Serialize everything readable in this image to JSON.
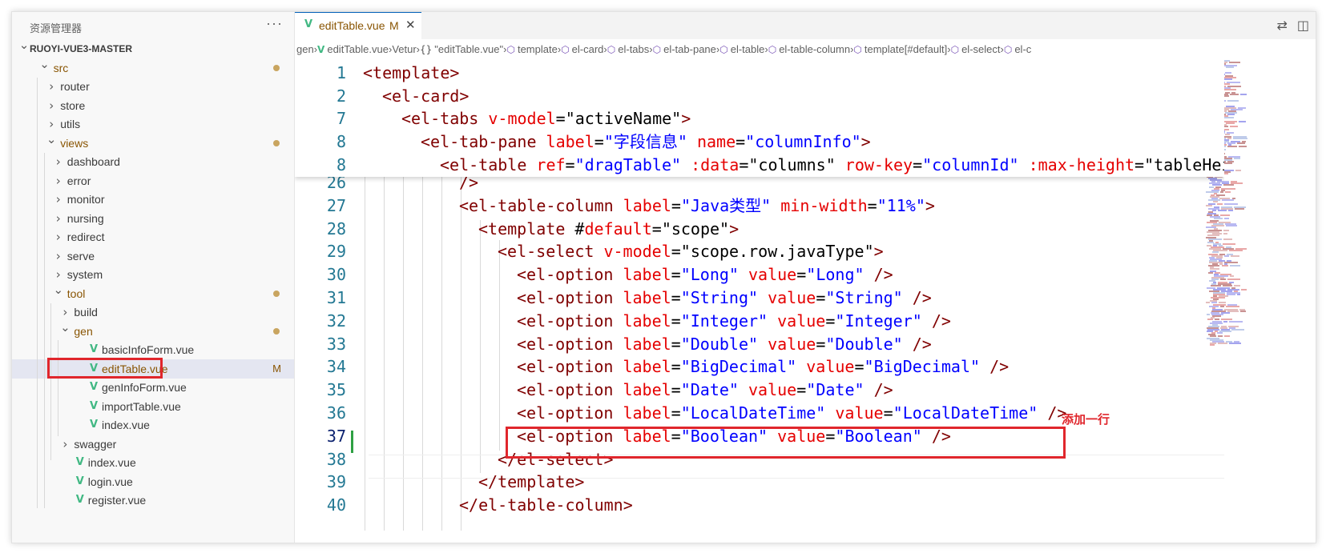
{
  "explorer": {
    "title": "资源管理器",
    "more_label": "···",
    "tree": [
      {
        "label": "RUOYI-VUE3-MASTER",
        "kind": "root",
        "expanded": true,
        "depth": 0,
        "modified_dot": false
      },
      {
        "label": "src",
        "kind": "folder",
        "expanded": true,
        "depth": 1,
        "modified_dot": true,
        "modified": true
      },
      {
        "label": "router",
        "kind": "folder",
        "expanded": false,
        "depth": 2,
        "modified_dot": false
      },
      {
        "label": "store",
        "kind": "folder",
        "expanded": false,
        "depth": 2,
        "modified_dot": false
      },
      {
        "label": "utils",
        "kind": "folder",
        "expanded": false,
        "depth": 2,
        "modified_dot": false
      },
      {
        "label": "views",
        "kind": "folder",
        "expanded": true,
        "depth": 2,
        "modified_dot": true,
        "modified": true
      },
      {
        "label": "dashboard",
        "kind": "folder",
        "expanded": false,
        "depth": 3,
        "modified_dot": false
      },
      {
        "label": "error",
        "kind": "folder",
        "expanded": false,
        "depth": 3,
        "modified_dot": false
      },
      {
        "label": "monitor",
        "kind": "folder",
        "expanded": false,
        "depth": 3,
        "modified_dot": false
      },
      {
        "label": "nursing",
        "kind": "folder",
        "expanded": false,
        "depth": 3,
        "modified_dot": false
      },
      {
        "label": "redirect",
        "kind": "folder",
        "expanded": false,
        "depth": 3,
        "modified_dot": false
      },
      {
        "label": "serve",
        "kind": "folder",
        "expanded": false,
        "depth": 3,
        "modified_dot": false
      },
      {
        "label": "system",
        "kind": "folder",
        "expanded": false,
        "depth": 3,
        "modified_dot": false
      },
      {
        "label": "tool",
        "kind": "folder",
        "expanded": true,
        "depth": 3,
        "modified_dot": true,
        "modified": true
      },
      {
        "label": "build",
        "kind": "folder",
        "expanded": false,
        "depth": 4,
        "modified_dot": false
      },
      {
        "label": "gen",
        "kind": "folder",
        "expanded": true,
        "depth": 4,
        "modified_dot": true,
        "modified": true
      },
      {
        "label": "basicInfoForm.vue",
        "kind": "vue",
        "depth": 5,
        "modified_dot": false
      },
      {
        "label": "editTable.vue",
        "kind": "vue",
        "depth": 5,
        "selected": true,
        "modified": true,
        "flag": "M"
      },
      {
        "label": "genInfoForm.vue",
        "kind": "vue",
        "depth": 5,
        "modified_dot": false
      },
      {
        "label": "importTable.vue",
        "kind": "vue",
        "depth": 5,
        "modified_dot": false
      },
      {
        "label": "index.vue",
        "kind": "vue",
        "depth": 5,
        "modified_dot": false
      },
      {
        "label": "swagger",
        "kind": "folder",
        "expanded": false,
        "depth": 4,
        "modified_dot": false
      },
      {
        "label": "index.vue",
        "kind": "vue",
        "depth": 3,
        "modified_dot": false
      },
      {
        "label": "login.vue",
        "kind": "vue",
        "depth": 3,
        "modified_dot": false
      },
      {
        "label": "register.vue",
        "kind": "vue",
        "depth": 3,
        "modified_dot": false
      }
    ]
  },
  "tab": {
    "label": "editTable.vue",
    "flag": "M",
    "close": "✕",
    "icon": "vue-icon"
  },
  "tab_actions": {
    "compare": "⇄",
    "split": "◫"
  },
  "breadcrumb": [
    {
      "label": "gen",
      "icon": ""
    },
    {
      "label": "editTable.vue",
      "icon": "vue"
    },
    {
      "label": "Vetur",
      "icon": ""
    },
    {
      "label": "\"editTable.vue\"",
      "icon": "braces"
    },
    {
      "label": "template",
      "icon": "cube"
    },
    {
      "label": "el-card",
      "icon": "cube"
    },
    {
      "label": "el-tabs",
      "icon": "cube"
    },
    {
      "label": "el-tab-pane",
      "icon": "cube"
    },
    {
      "label": "el-table",
      "icon": "cube"
    },
    {
      "label": "el-table-column",
      "icon": "cube"
    },
    {
      "label": "template[#default]",
      "icon": "cube"
    },
    {
      "label": "el-select",
      "icon": "cube"
    },
    {
      "label": "el-c",
      "icon": "cube"
    }
  ],
  "sticky_lines": [
    {
      "num": "1",
      "indent": 0,
      "tokens": [
        [
          "tag",
          "<template>"
        ]
      ]
    },
    {
      "num": "2",
      "indent": 1,
      "tokens": [
        [
          "tag",
          "<el-card>"
        ]
      ]
    },
    {
      "num": "7",
      "indent": 2,
      "tokens": [
        [
          "tag",
          "<el-tabs "
        ],
        [
          "attr",
          "v-model"
        ],
        [
          "eq",
          "="
        ],
        [
          "str2",
          "\"activeName\""
        ],
        [
          "tag",
          ">"
        ]
      ]
    },
    {
      "num": "8",
      "indent": 3,
      "tokens": [
        [
          "tag",
          "<el-tab-pane "
        ],
        [
          "attr",
          "label"
        ],
        [
          "eq",
          "="
        ],
        [
          "str",
          "\"字段信息\""
        ],
        [
          "plain",
          " "
        ],
        [
          "attr",
          "name"
        ],
        [
          "eq",
          "="
        ],
        [
          "str",
          "\"columnInfo\""
        ],
        [
          "tag",
          ">"
        ]
      ]
    },
    {
      "num": "8",
      "indent": 4,
      "tokens": [
        [
          "tag",
          "<el-table "
        ],
        [
          "attr",
          "ref"
        ],
        [
          "eq",
          "="
        ],
        [
          "str",
          "\"dragTable\""
        ],
        [
          "plain",
          " "
        ],
        [
          "attr",
          ":data"
        ],
        [
          "eq",
          "="
        ],
        [
          "str2",
          "\"columns\""
        ],
        [
          "plain",
          " "
        ],
        [
          "attr",
          "row-key"
        ],
        [
          "eq",
          "="
        ],
        [
          "str",
          "\"columnId\""
        ],
        [
          "plain",
          " "
        ],
        [
          "attr",
          ":max-height"
        ],
        [
          "eq",
          "="
        ],
        [
          "str2",
          "\"tableHeig"
        ]
      ]
    }
  ],
  "code_lines": [
    {
      "num": "26",
      "indent": 5,
      "tokens": [
        [
          "tag",
          "/>"
        ]
      ]
    },
    {
      "num": "27",
      "indent": 5,
      "tokens": [
        [
          "tag",
          "<el-table-column "
        ],
        [
          "attr",
          "label"
        ],
        [
          "eq",
          "="
        ],
        [
          "str",
          "\"Java类型\""
        ],
        [
          "plain",
          " "
        ],
        [
          "attr",
          "min-width"
        ],
        [
          "eq",
          "="
        ],
        [
          "str",
          "\"11%\""
        ],
        [
          "tag",
          ">"
        ]
      ]
    },
    {
      "num": "28",
      "indent": 6,
      "tokens": [
        [
          "tag",
          "<template "
        ],
        [
          "plain",
          "#"
        ],
        [
          "attr",
          "default"
        ],
        [
          "eq",
          "="
        ],
        [
          "str2",
          "\"scope\""
        ],
        [
          "tag",
          ">"
        ]
      ]
    },
    {
      "num": "29",
      "indent": 7,
      "tokens": [
        [
          "tag",
          "<el-select "
        ],
        [
          "attr",
          "v-model"
        ],
        [
          "eq",
          "="
        ],
        [
          "str2",
          "\"scope.row.javaType\""
        ],
        [
          "tag",
          ">"
        ]
      ]
    },
    {
      "num": "30",
      "indent": 8,
      "tokens": [
        [
          "tag",
          "<el-option "
        ],
        [
          "attr",
          "label"
        ],
        [
          "eq",
          "="
        ],
        [
          "str",
          "\"Long\""
        ],
        [
          "plain",
          " "
        ],
        [
          "attr",
          "value"
        ],
        [
          "eq",
          "="
        ],
        [
          "str",
          "\"Long\""
        ],
        [
          "plain",
          " "
        ],
        [
          "tag",
          "/>"
        ]
      ]
    },
    {
      "num": "31",
      "indent": 8,
      "tokens": [
        [
          "tag",
          "<el-option "
        ],
        [
          "attr",
          "label"
        ],
        [
          "eq",
          "="
        ],
        [
          "str",
          "\"String\""
        ],
        [
          "plain",
          " "
        ],
        [
          "attr",
          "value"
        ],
        [
          "eq",
          "="
        ],
        [
          "str",
          "\"String\""
        ],
        [
          "plain",
          " "
        ],
        [
          "tag",
          "/>"
        ]
      ]
    },
    {
      "num": "32",
      "indent": 8,
      "tokens": [
        [
          "tag",
          "<el-option "
        ],
        [
          "attr",
          "label"
        ],
        [
          "eq",
          "="
        ],
        [
          "str",
          "\"Integer\""
        ],
        [
          "plain",
          " "
        ],
        [
          "attr",
          "value"
        ],
        [
          "eq",
          "="
        ],
        [
          "str",
          "\"Integer\""
        ],
        [
          "plain",
          " "
        ],
        [
          "tag",
          "/>"
        ]
      ]
    },
    {
      "num": "33",
      "indent": 8,
      "tokens": [
        [
          "tag",
          "<el-option "
        ],
        [
          "attr",
          "label"
        ],
        [
          "eq",
          "="
        ],
        [
          "str",
          "\"Double\""
        ],
        [
          "plain",
          " "
        ],
        [
          "attr",
          "value"
        ],
        [
          "eq",
          "="
        ],
        [
          "str",
          "\"Double\""
        ],
        [
          "plain",
          " "
        ],
        [
          "tag",
          "/>"
        ]
      ]
    },
    {
      "num": "34",
      "indent": 8,
      "tokens": [
        [
          "tag",
          "<el-option "
        ],
        [
          "attr",
          "label"
        ],
        [
          "eq",
          "="
        ],
        [
          "str",
          "\"BigDecimal\""
        ],
        [
          "plain",
          " "
        ],
        [
          "attr",
          "value"
        ],
        [
          "eq",
          "="
        ],
        [
          "str",
          "\"BigDecimal\""
        ],
        [
          "plain",
          " "
        ],
        [
          "tag",
          "/>"
        ]
      ]
    },
    {
      "num": "35",
      "indent": 8,
      "tokens": [
        [
          "tag",
          "<el-option "
        ],
        [
          "attr",
          "label"
        ],
        [
          "eq",
          "="
        ],
        [
          "str",
          "\"Date\""
        ],
        [
          "plain",
          " "
        ],
        [
          "attr",
          "value"
        ],
        [
          "eq",
          "="
        ],
        [
          "str",
          "\"Date\""
        ],
        [
          "plain",
          " "
        ],
        [
          "tag",
          "/>"
        ]
      ]
    },
    {
      "num": "36",
      "indent": 8,
      "tokens": [
        [
          "tag",
          "<el-option "
        ],
        [
          "attr",
          "label"
        ],
        [
          "eq",
          "="
        ],
        [
          "str",
          "\"LocalDateTime\""
        ],
        [
          "plain",
          " "
        ],
        [
          "attr",
          "value"
        ],
        [
          "eq",
          "="
        ],
        [
          "str",
          "\"LocalDateTime\""
        ],
        [
          "plain",
          " "
        ],
        [
          "tag",
          "/>"
        ]
      ],
      "highlighted": true
    },
    {
      "num": "37",
      "indent": 8,
      "tokens": [
        [
          "tag",
          "<el-option "
        ],
        [
          "attr",
          "label"
        ],
        [
          "eq",
          "="
        ],
        [
          "str",
          "\"Boolean\""
        ],
        [
          "plain",
          " "
        ],
        [
          "attr",
          "value"
        ],
        [
          "eq",
          "="
        ],
        [
          "str",
          "\"Boolean\""
        ],
        [
          "plain",
          " "
        ],
        [
          "tag",
          "/>"
        ]
      ],
      "active": true
    },
    {
      "num": "38",
      "indent": 7,
      "tokens": [
        [
          "tag",
          "</el-select>"
        ]
      ]
    },
    {
      "num": "39",
      "indent": 6,
      "tokens": [
        [
          "tag",
          "</template>"
        ]
      ]
    },
    {
      "num": "40",
      "indent": 5,
      "tokens": [
        [
          "tag",
          "</el-table-column>"
        ]
      ]
    }
  ],
  "annotation": "添加一行",
  "colors": {
    "tag": "#800000",
    "attr": "#e50000",
    "string": "#0000ff",
    "line_number": "#237893",
    "modified": "#895503",
    "vue": "#41b883",
    "highlight_box": "#e0262c"
  }
}
